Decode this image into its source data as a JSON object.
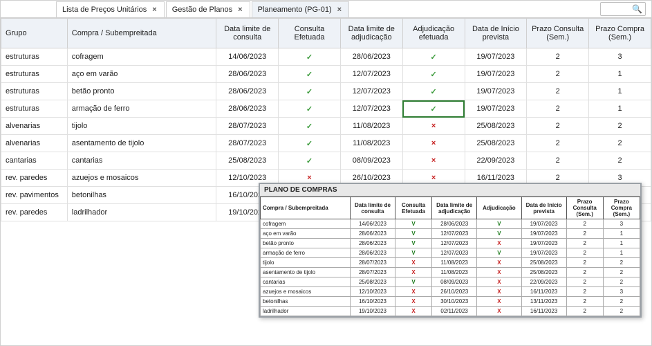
{
  "tabs": [
    {
      "label": "Lista de Preços Unitários",
      "active": false
    },
    {
      "label": "Gestão de Planos",
      "active": false
    },
    {
      "label": "Planeamento (PG-01)",
      "active": true
    }
  ],
  "columns": {
    "grupo": "Grupo",
    "compra": "Compra / Subempreitada",
    "dl_consulta": "Data limite de consulta",
    "consulta_efet": "Consulta Efetuada",
    "dl_adj": "Data limite de adjudicação",
    "adj_efet": "Adjudicação efetuada",
    "d_inicio": "Data de Início prevista",
    "prazo_cons": "Prazo Consulta (Sem.)",
    "prazo_comp": "Prazo Compra (Sem.)"
  },
  "rows": [
    {
      "grupo": "estruturas",
      "compra": "cofragem",
      "dlc": "14/06/2023",
      "ce": "v",
      "dla": "28/06/2023",
      "ae": "v",
      "di": "19/07/2023",
      "pc": "2",
      "pcp": "3",
      "sel": false
    },
    {
      "grupo": "estruturas",
      "compra": "aço em varão",
      "dlc": "28/06/2023",
      "ce": "v",
      "dla": "12/07/2023",
      "ae": "v",
      "di": "19/07/2023",
      "pc": "2",
      "pcp": "1",
      "sel": false
    },
    {
      "grupo": "estruturas",
      "compra": "betão pronto",
      "dlc": "28/06/2023",
      "ce": "v",
      "dla": "12/07/2023",
      "ae": "v",
      "di": "19/07/2023",
      "pc": "2",
      "pcp": "1",
      "sel": false
    },
    {
      "grupo": "estruturas",
      "compra": "armação de ferro",
      "dlc": "28/06/2023",
      "ce": "v",
      "dla": "12/07/2023",
      "ae": "v",
      "di": "19/07/2023",
      "pc": "2",
      "pcp": "1",
      "sel": true
    },
    {
      "grupo": "alvenarias",
      "compra": "tijolo",
      "dlc": "28/07/2023",
      "ce": "v",
      "dla": "11/08/2023",
      "ae": "x",
      "di": "25/08/2023",
      "pc": "2",
      "pcp": "2",
      "sel": false
    },
    {
      "grupo": "alvenarias",
      "compra": "asentamento de tijolo",
      "dlc": "28/07/2023",
      "ce": "v",
      "dla": "11/08/2023",
      "ae": "x",
      "di": "25/08/2023",
      "pc": "2",
      "pcp": "2",
      "sel": false
    },
    {
      "grupo": "cantarias",
      "compra": "cantarias",
      "dlc": "25/08/2023",
      "ce": "v",
      "dla": "08/09/2023",
      "ae": "x",
      "di": "22/09/2023",
      "pc": "2",
      "pcp": "2",
      "sel": false
    },
    {
      "grupo": "rev. paredes",
      "compra": "azuejos e mosaicos",
      "dlc": "12/10/2023",
      "ce": "x",
      "dla": "26/10/2023",
      "ae": "x",
      "di": "16/11/2023",
      "pc": "2",
      "pcp": "3",
      "sel": false
    },
    {
      "grupo": "rev. pavimentos",
      "compra": "betonilhas",
      "dlc": "16/10/2023",
      "ce": "x",
      "dla": "30/10/2023",
      "ae": "x",
      "di": "13/11/2023",
      "pc": "2",
      "pcp": "2",
      "sel": false
    },
    {
      "grupo": "rev. paredes",
      "compra": "ladrilhador",
      "dlc": "19/10/2023",
      "ce": "x",
      "dla": "02/11/2023",
      "ae": "x",
      "di": "16/11/2023",
      "pc": "2",
      "pcp": "2",
      "sel": false
    }
  ],
  "overlay": {
    "title": "PLANO DE COMPRAS",
    "columns": {
      "compra": "Compra / Subempreitada",
      "dl_consulta": "Data limite de consulta",
      "consulta_efet": "Consulta Efetuada",
      "dl_adj": "Data limite de adjudicação",
      "adj": "Adjudicação",
      "d_inicio": "Data de Início prevista",
      "prazo_cons": "Prazo Consulta (Sem.)",
      "prazo_comp": "Prazo Compra (Sem.)"
    },
    "rows": [
      {
        "compra": "cofragem",
        "dlc": "14/06/2023",
        "ce": "v",
        "dla": "28/06/2023",
        "ae": "v",
        "di": "19/07/2023",
        "pc": "2",
        "pcp": "3"
      },
      {
        "compra": "aço em varão",
        "dlc": "28/06/2023",
        "ce": "v",
        "dla": "12/07/2023",
        "ae": "v",
        "di": "19/07/2023",
        "pc": "2",
        "pcp": "1"
      },
      {
        "compra": "betão pronto",
        "dlc": "28/06/2023",
        "ce": "v",
        "dla": "12/07/2023",
        "ae": "x",
        "di": "19/07/2023",
        "pc": "2",
        "pcp": "1"
      },
      {
        "compra": "armação de ferro",
        "dlc": "28/06/2023",
        "ce": "v",
        "dla": "12/07/2023",
        "ae": "v",
        "di": "19/07/2023",
        "pc": "2",
        "pcp": "1"
      },
      {
        "compra": "tijolo",
        "dlc": "28/07/2023",
        "ce": "x",
        "dla": "11/08/2023",
        "ae": "x",
        "di": "25/08/2023",
        "pc": "2",
        "pcp": "2"
      },
      {
        "compra": "asentamento de tijolo",
        "dlc": "28/07/2023",
        "ce": "x",
        "dla": "11/08/2023",
        "ae": "x",
        "di": "25/08/2023",
        "pc": "2",
        "pcp": "2"
      },
      {
        "compra": "cantarias",
        "dlc": "25/08/2023",
        "ce": "v",
        "dla": "08/09/2023",
        "ae": "x",
        "di": "22/09/2023",
        "pc": "2",
        "pcp": "2"
      },
      {
        "compra": "azuejos e mosaicos",
        "dlc": "12/10/2023",
        "ce": "x",
        "dla": "26/10/2023",
        "ae": "x",
        "di": "16/11/2023",
        "pc": "2",
        "pcp": "3"
      },
      {
        "compra": "betonilhas",
        "dlc": "16/10/2023",
        "ce": "x",
        "dla": "30/10/2023",
        "ae": "x",
        "di": "13/11/2023",
        "pc": "2",
        "pcp": "2"
      },
      {
        "compra": "ladrilhador",
        "dlc": "19/10/2023",
        "ce": "x",
        "dla": "02/11/2023",
        "ae": "x",
        "di": "16/11/2023",
        "pc": "2",
        "pcp": "2"
      }
    ]
  },
  "chart_data": {
    "type": "table",
    "title": "Planeamento (PG-01)",
    "columns": [
      "Grupo",
      "Compra / Subempreitada",
      "Data limite de consulta",
      "Consulta Efetuada",
      "Data limite de adjudicação",
      "Adjudicação efetuada",
      "Data de Início prevista",
      "Prazo Consulta (Sem.)",
      "Prazo Compra (Sem.)"
    ],
    "rows": [
      [
        "estruturas",
        "cofragem",
        "14/06/2023",
        true,
        "28/06/2023",
        true,
        "19/07/2023",
        2,
        3
      ],
      [
        "estruturas",
        "aço em varão",
        "28/06/2023",
        true,
        "12/07/2023",
        true,
        "19/07/2023",
        2,
        1
      ],
      [
        "estruturas",
        "betão pronto",
        "28/06/2023",
        true,
        "12/07/2023",
        true,
        "19/07/2023",
        2,
        1
      ],
      [
        "estruturas",
        "armação de ferro",
        "28/06/2023",
        true,
        "12/07/2023",
        true,
        "19/07/2023",
        2,
        1
      ],
      [
        "alvenarias",
        "tijolo",
        "28/07/2023",
        true,
        "11/08/2023",
        false,
        "25/08/2023",
        2,
        2
      ],
      [
        "alvenarias",
        "asentamento de tijolo",
        "28/07/2023",
        true,
        "11/08/2023",
        false,
        "25/08/2023",
        2,
        2
      ],
      [
        "cantarias",
        "cantarias",
        "25/08/2023",
        true,
        "08/09/2023",
        false,
        "22/09/2023",
        2,
        2
      ],
      [
        "rev. paredes",
        "azuejos e mosaicos",
        "12/10/2023",
        false,
        "26/10/2023",
        false,
        "16/11/2023",
        2,
        3
      ],
      [
        "rev. pavimentos",
        "betonilhas",
        "16/10/2023",
        false,
        "30/10/2023",
        false,
        "13/11/2023",
        2,
        2
      ],
      [
        "rev. paredes",
        "ladrilhador",
        "19/10/2023",
        false,
        "02/11/2023",
        false,
        "16/11/2023",
        2,
        2
      ]
    ]
  }
}
